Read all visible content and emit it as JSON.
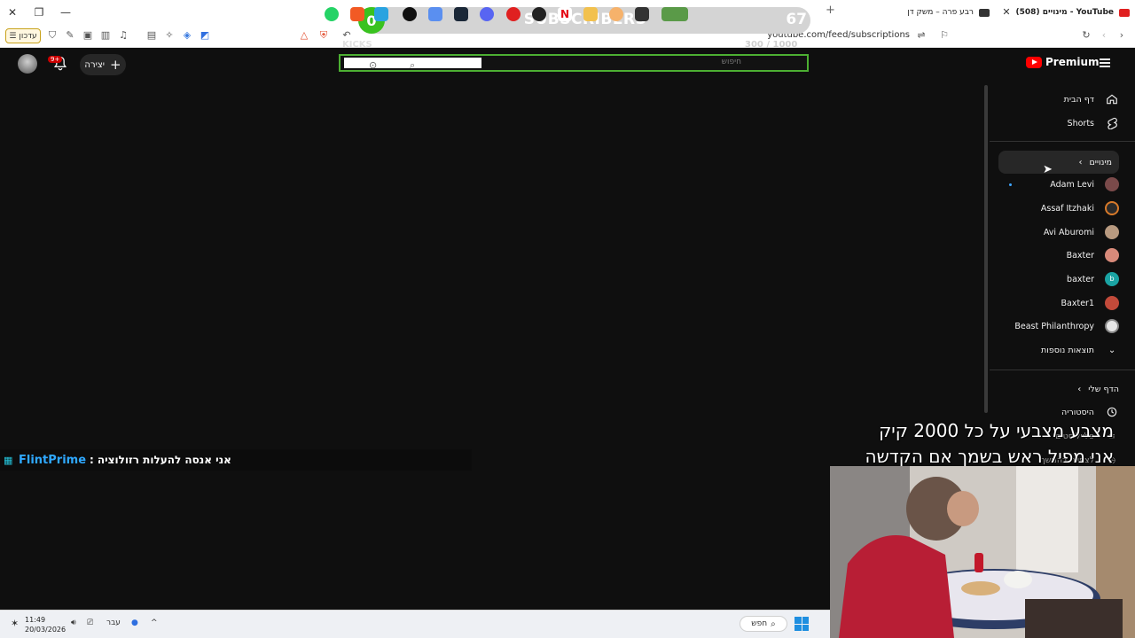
{
  "browser": {
    "tabs": [
      {
        "title": "YouTube - מינויים (508)",
        "active": true,
        "favicon_color": "#e02020"
      },
      {
        "title": "רבע פרה – משק דן",
        "active": false,
        "favicon_color": "#333333"
      }
    ],
    "toolbar_menu_label": "עדכון",
    "url": "youtube.com/feed/subscriptions"
  },
  "youtube": {
    "logo_text": "Premium",
    "create_label": "יצירה",
    "bell_badge": "9+",
    "search_placeholder": "חיפוש",
    "sidebar": {
      "home": "דף הבית",
      "shorts": "Shorts",
      "subscriptions": "מינויים",
      "channels": [
        {
          "name": "Adam Levi",
          "color": "#7a4a4a",
          "new": true
        },
        {
          "name": "Assaf Itzhaki",
          "color": "#3a3a3a",
          "new": false
        },
        {
          "name": "Avi Aburomi",
          "color": "#b89a80",
          "new": false
        },
        {
          "name": "Baxter",
          "color": "#d88a7a",
          "new": false
        },
        {
          "name": "baxter",
          "color": "#1aa3a3",
          "letter": "b",
          "new": false
        },
        {
          "name": "Baxter1",
          "color": "#c24a3a",
          "new": false
        },
        {
          "name": "Beast Philanthropy",
          "color": "#e6e6e6",
          "new": false
        }
      ],
      "show_more": "תוצאות נוספות",
      "you_section": "הדף שלי",
      "history": "היסטוריה",
      "playlists": "פלייליסטים",
      "watch_later": "לצפייה בהמשך"
    }
  },
  "overlay": {
    "subscribers": {
      "current": "0",
      "title": "SUBSCRIBERS",
      "goal": "67"
    },
    "kicks": {
      "label": "KICKS",
      "value": "300 / 1000"
    },
    "chat": {
      "user": "FlintPrime",
      "message": "אני אנסה להעלות רזולוציה"
    },
    "cam_lines": [
      "מצבע מצבעי על כל 2000 קיק",
      "אני מפיל ראש בשמך  אם הקדשה"
    ]
  },
  "taskbar": {
    "time": "11:49",
    "date": "20/03/2026",
    "lang": "עבר",
    "search_label": "חפש"
  },
  "colors": {
    "youtube_red": "#ff0000",
    "subscriber_green": "#39c21f",
    "chat_user_blue": "#2fa8ff",
    "search_border_green": "#4caf32"
  }
}
